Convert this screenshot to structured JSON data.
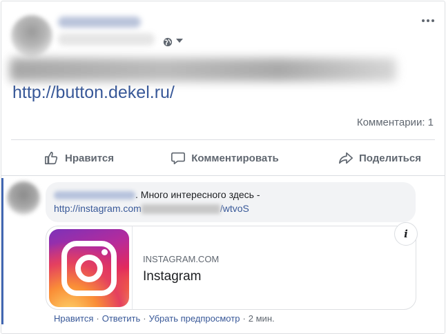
{
  "post": {
    "link": "http://button.dekel.ru/",
    "comments_count": "Комментарии: 1",
    "icons": {
      "privacy": "globe-icon",
      "more": "more-options-icon"
    }
  },
  "actions": [
    {
      "label": "Нравится",
      "icon": "like-icon"
    },
    {
      "label": "Комментировать",
      "icon": "comment-icon"
    },
    {
      "label": "Поделиться",
      "icon": "share-icon"
    }
  ],
  "comment": {
    "text": ". Много интересного здесь -",
    "link_start": "http://instagram.com",
    "link_end": "/wtvoS",
    "preview": {
      "domain": "INSTAGRAM.COM",
      "title": "Instagram",
      "info_icon": "info-icon"
    },
    "actions": {
      "like": "Нравится",
      "reply": "Ответить",
      "remove_preview": "Убрать предпросмотр",
      "time": "2 мин."
    }
  },
  "colors": {
    "link": "#385898",
    "muted": "#606770",
    "bubble_bg": "#f2f3f5",
    "focus_bar": "#4267b2"
  }
}
